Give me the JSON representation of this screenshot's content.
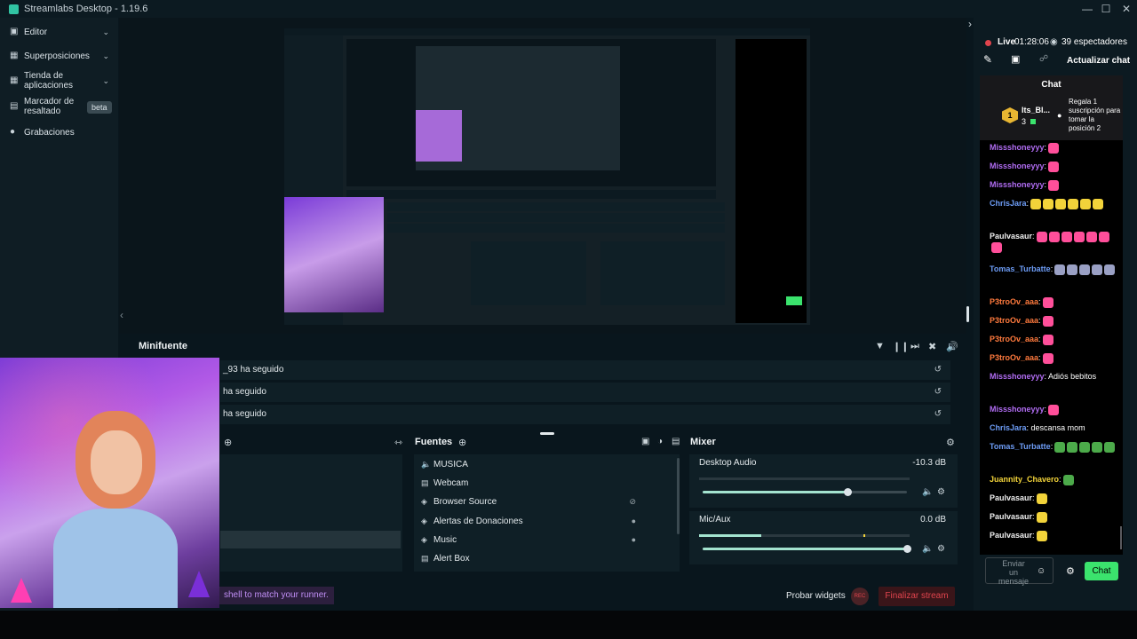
{
  "window": {
    "title": "Streamlabs Desktop - 1.19.6"
  },
  "colors": {
    "accent": "#31c3a2",
    "live": "#e0444d",
    "chat_button": "#3be36d",
    "finalize": "#e0444d",
    "bg": "#09161d"
  },
  "sidebar": {
    "items": [
      {
        "label": "Editor",
        "icon": "monitor-icon",
        "chevron": true
      },
      {
        "label": "Superposiciones",
        "icon": "overlays-icon",
        "chevron": true
      },
      {
        "label": "Tienda de aplicaciones",
        "icon": "store-icon",
        "chevron": true
      },
      {
        "label": "Marcador de resaltado",
        "icon": "clapper-icon",
        "badge": "beta"
      },
      {
        "label": "Grabaciones",
        "icon": "record-icon"
      }
    ]
  },
  "minifuente": {
    "title": "Minifuente"
  },
  "events": [
    {
      "text": "_93  ha seguido"
    },
    {
      "text": "ha seguido"
    },
    {
      "text": "ha seguido"
    }
  ],
  "sources": {
    "title": "Fuentes",
    "items": [
      {
        "label": "MUSICA",
        "icon": "speaker-icon"
      },
      {
        "label": "Webcam",
        "icon": "folder-icon"
      },
      {
        "label": "Browser Source",
        "icon": "globe-icon",
        "status": "hidden-eye-icon"
      },
      {
        "label": "Alertas de Donaciones",
        "icon": "globe-icon",
        "status": "lock-icon"
      },
      {
        "label": "Music",
        "icon": "globe-icon",
        "status": "lock-icon"
      },
      {
        "label": "Alert Box",
        "icon": "folder-icon"
      }
    ]
  },
  "mixer": {
    "title": "Mixer",
    "channels": [
      {
        "name": "Desktop Audio",
        "value": "-10.3 dB",
        "level": 0.71
      },
      {
        "name": "Mic/Aux",
        "value": "0.0 dB",
        "level": 1.0
      }
    ]
  },
  "footer": {
    "ticker": "shell to match your runner.",
    "test_widgets": "Probar widgets",
    "rec": "REC",
    "end_stream": "Finalizar stream"
  },
  "stream": {
    "live_label": "Live",
    "time": "01:28:06",
    "viewers": "39 espectadores",
    "refresh_chat": "Actualizar chat"
  },
  "chat": {
    "title": "Chat",
    "sub_gift": {
      "user": "Its_Bl...",
      "count": "3",
      "text": "Regala 1 suscripción para tomar la posición 2"
    },
    "messages": [
      {
        "user": "Missshoneyyy",
        "text": "",
        "color": "#b06cf2",
        "emotes": [
          "#ff4f9a"
        ]
      },
      {
        "user": "Missshoneyyy",
        "text": "",
        "color": "#b06cf2",
        "emotes": [
          "#ff4f9a"
        ]
      },
      {
        "user": "Missshoneyyy",
        "text": "",
        "color": "#b06cf2",
        "emotes": [
          "#ff4f9a"
        ]
      },
      {
        "user": "ChrisJara",
        "text": "",
        "color": "#6d9cf5",
        "emotes": [
          "#f2d33a",
          "#f2d33a",
          "#f2d33a",
          "#f2d33a",
          "#f2d33a",
          "#f2d33a"
        ]
      },
      {
        "user": "Paulvasaur",
        "text": "",
        "color": "#f0f0f0",
        "emotes": [
          "#ff4f9a",
          "#ff4f9a",
          "#ff4f9a",
          "#ff4f9a",
          "#ff4f9a",
          "#ff4f9a",
          "#ff4f9a"
        ]
      },
      {
        "user": "Tomas_Turbatte",
        "text": "",
        "color": "#6d9cf5",
        "emotes": [
          "#9aa0c4",
          "#9aa0c4",
          "#9aa0c4",
          "#9aa0c4",
          "#9aa0c4"
        ]
      },
      {
        "user": "P3troOv_aaa",
        "text": "",
        "color": "#ff7a3d",
        "emotes": [
          "#ff4f9a"
        ]
      },
      {
        "user": "P3troOv_aaa",
        "text": "",
        "color": "#ff7a3d",
        "emotes": [
          "#ff4f9a"
        ]
      },
      {
        "user": "P3troOv_aaa",
        "text": "",
        "color": "#ff7a3d",
        "emotes": [
          "#ff4f9a"
        ]
      },
      {
        "user": "P3troOv_aaa",
        "text": "",
        "color": "#ff7a3d",
        "emotes": [
          "#ff4f9a"
        ]
      },
      {
        "user": "Missshoneyyy",
        "text": "Adiós bebitos",
        "color": "#b06cf2",
        "emotes": []
      },
      {
        "user": "Missshoneyyy",
        "text": "",
        "color": "#b06cf2",
        "emotes": [
          "#ff4f9a"
        ]
      },
      {
        "user": "ChrisJara",
        "text": "descansa mom",
        "color": "#6d9cf5",
        "emotes": []
      },
      {
        "user": "Tomas_Turbatte",
        "text": "",
        "color": "#6d9cf5",
        "emotes": [
          "#4caa4a",
          "#4caa4a",
          "#4caa4a",
          "#4caa4a",
          "#4caa4a"
        ]
      },
      {
        "user": "Juannity_Chavero",
        "text": "",
        "color": "#f2d33a",
        "emotes": [
          "#4caa4a"
        ]
      },
      {
        "user": "Paulvasaur",
        "text": "",
        "color": "#f0f0f0",
        "emotes": [
          "#f2d33a"
        ]
      },
      {
        "user": "Paulvasaur",
        "text": "",
        "color": "#f0f0f0",
        "emotes": [
          "#f2d33a"
        ]
      },
      {
        "user": "Paulvasaur",
        "text": "",
        "color": "#f0f0f0",
        "emotes": [
          "#f2d33a"
        ]
      },
      {
        "user": "Paulvasaur",
        "text": "",
        "color": "#f0f0f0",
        "emotes": [
          "#e23b3b"
        ]
      }
    ],
    "input_placeholder": "Enviar un mensaje",
    "send_label": "Chat"
  }
}
